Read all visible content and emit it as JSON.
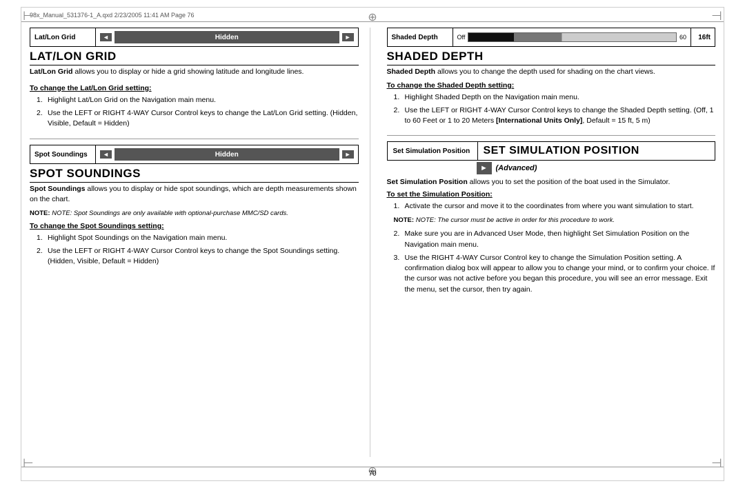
{
  "page": {
    "file_info": "98x_Manual_531376-1_A.qxd   2/23/2005   11:41 AM   Page 76",
    "page_number": "70"
  },
  "left_col": {
    "lat_lon_section": {
      "widget_label": "Lat/Lon Grid",
      "widget_control_text": "Hidden",
      "section_title": "LAT/LON GRID",
      "intro_bold": "Lat/Lon Grid",
      "intro_text": " allows you to display or hide a grid showing latitude and longitude lines.",
      "change_heading": "To change the Lat/Lon Grid setting:",
      "steps": [
        "Highlight Lat/Lon Grid on the Navigation main menu.",
        "Use the LEFT or RIGHT 4-WAY Cursor Control keys to change the Lat/Lon Grid setting. (Hidden, Visible, Default = Hidden)"
      ]
    },
    "spot_soundings_section": {
      "widget_label": "Spot  Soundings",
      "widget_control_text": "Hidden",
      "section_title": "SPOT SOUNDINGS",
      "intro_bold": "Spot Soundings",
      "intro_text": " allows you to display or hide spot soundings, which are depth measurements shown on the chart.",
      "note": "NOTE: Spot Soundings are only available with optional-purchase MMC/SD cards.",
      "change_heading": "To change the Spot Soundings setting:",
      "steps": [
        "Highlight Spot Soundings on the Navigation main menu.",
        "Use the LEFT or RIGHT 4-WAY Cursor Control keys to change the Spot Soundings setting. (Hidden, Visible, Default = Hidden)"
      ]
    }
  },
  "right_col": {
    "shaded_depth_section": {
      "widget_label": "Shaded Depth",
      "widget_value_num": "16ft",
      "slider_off": "Off",
      "slider_60": "60",
      "section_title": "SHADED DEPTH",
      "intro_bold": "Shaded Depth",
      "intro_text": " allows you to change the depth used for shading on the chart views.",
      "change_heading": "To change the Shaded Depth setting:",
      "steps": [
        "Highlight Shaded Depth on the Navigation main menu.",
        "Use the LEFT or RIGHT 4-WAY Cursor Control keys to change the Shaded Depth setting. (Off, 1 to 60 Feet or 1 to 20 Meters [International Units Only], Default = 15 ft, 5 m)"
      ],
      "international_bold": "[International Units Only]"
    },
    "sim_position_section": {
      "widget_label": "Set  Simulation Position",
      "section_title": "SET SIMULATION POSITION",
      "advanced_label": "(Advanced)",
      "intro_bold": "Set Simulation Position",
      "intro_text": " allows you to set the position of the boat used in the Simulator.",
      "change_heading": "To set the Simulation Position:",
      "steps": [
        "Activate the cursor and move it to the coordinates from where you want simulation to start.",
        "Make sure you are in Advanced User Mode, then highlight Set Simulation Position on the Navigation main menu.",
        "Use the RIGHT 4-WAY Cursor Control key to change the Simulation Position setting.  A confirmation dialog box will appear to allow you to change your mind, or to confirm your choice. If the cursor was not active before you began this procedure, you will see an error message. Exit the menu, set the cursor, then try again."
      ],
      "note": "NOTE: The cursor must be active in order for this procedure to work."
    }
  },
  "icons": {
    "arrow_left": "◄",
    "arrow_right": "►",
    "crosshair": "⊕"
  }
}
